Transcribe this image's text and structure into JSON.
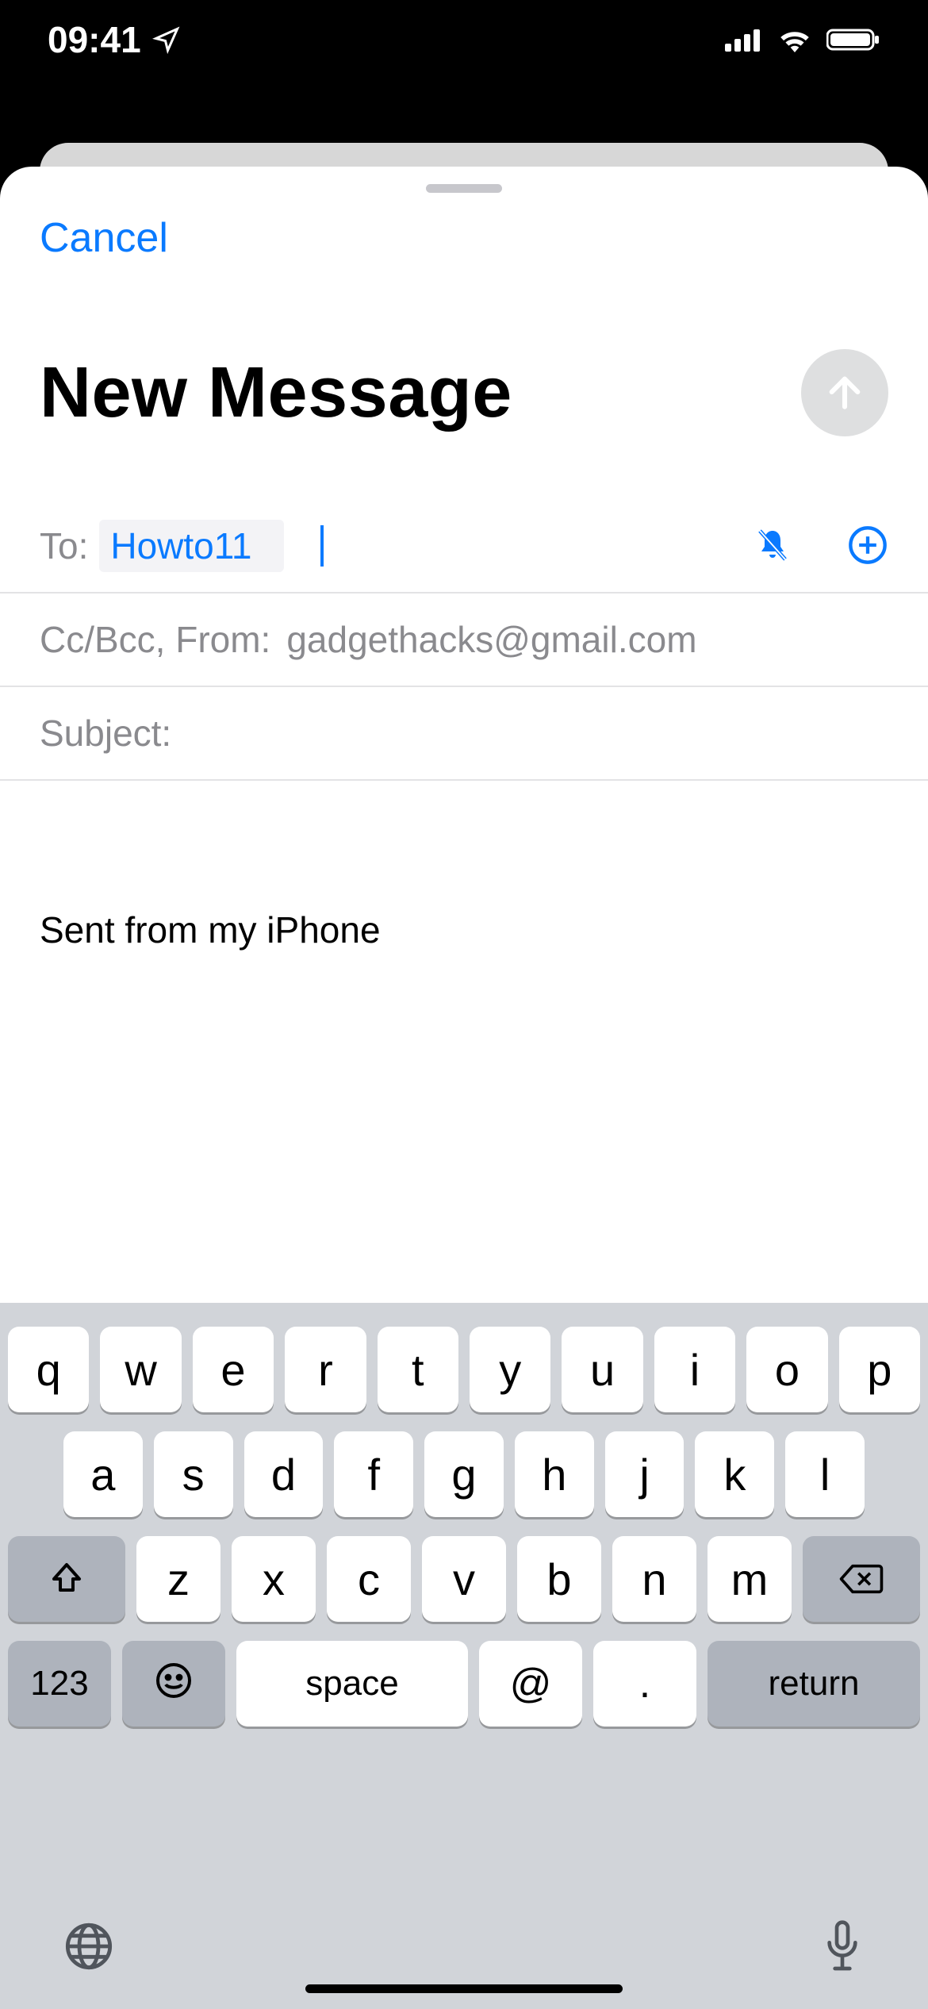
{
  "status": {
    "time": "09:41"
  },
  "nav": {
    "cancel": "Cancel"
  },
  "compose": {
    "title": "New Message",
    "to_label": "To:",
    "to_chip": "Howto11",
    "ccbcc_label": "Cc/Bcc, From:",
    "from_email": "gadgethacks@gmail.com",
    "subject_label": "Subject:",
    "body_signature": "Sent from my iPhone"
  },
  "keyboard": {
    "row1": [
      "q",
      "w",
      "e",
      "r",
      "t",
      "y",
      "u",
      "i",
      "o",
      "p"
    ],
    "row2": [
      "a",
      "s",
      "d",
      "f",
      "g",
      "h",
      "j",
      "k",
      "l"
    ],
    "row3": [
      "z",
      "x",
      "c",
      "v",
      "b",
      "n",
      "m"
    ],
    "num": "123",
    "space": "space",
    "at": "@",
    "dot": ".",
    "ret": "return"
  }
}
